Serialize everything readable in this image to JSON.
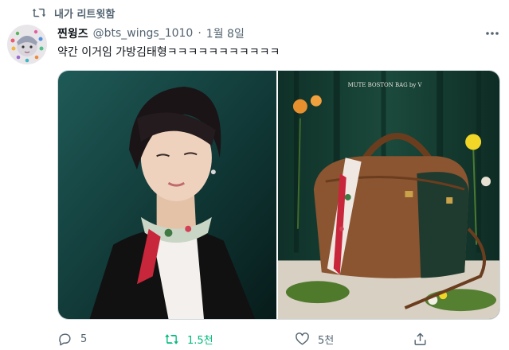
{
  "retweet_banner": {
    "text": "내가 리트윗함",
    "icon": "retweet-icon"
  },
  "author": {
    "display_name": "찐윙즈",
    "handle": "@bts_wings_1010",
    "separator": "·",
    "date": "1월 8일"
  },
  "tweet": {
    "text": "약간 이거임 가방김태형ㅋㅋㅋㅋㅋㅋㅋㅋㅋㅋㅋ"
  },
  "media": {
    "left_icon": "photo-person",
    "right_icon": "photo-bag",
    "right_caption": "MUTE BOSTON BAG by V"
  },
  "actions": {
    "reply_count": "5",
    "retweet_count": "1.5천",
    "like_count": "5천"
  },
  "colors": {
    "muted": "#536471",
    "retweet_active": "#00ba7c",
    "border": "#cfd9de"
  }
}
